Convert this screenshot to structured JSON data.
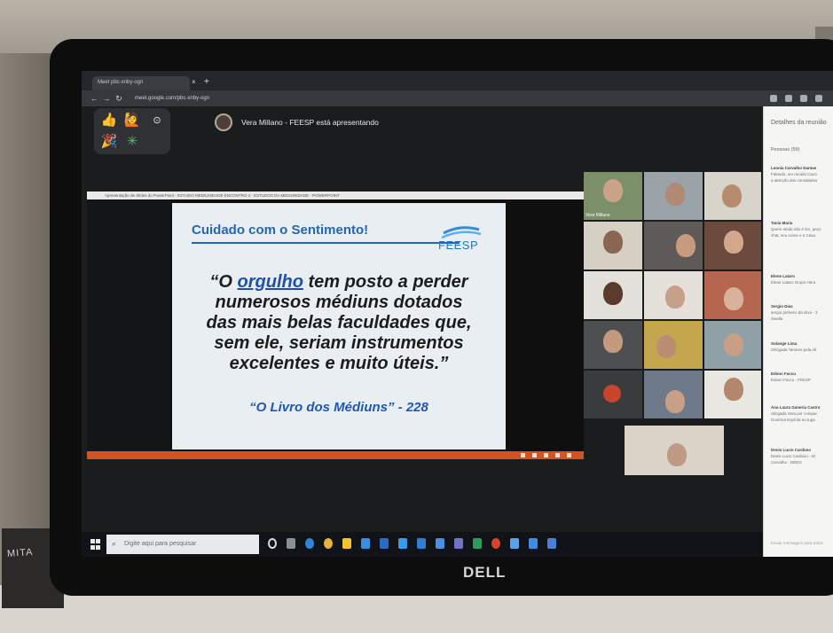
{
  "browser": {
    "tab_title": "Meet pbc-xnby-ogn",
    "tab_close": "×",
    "tab_new": "+",
    "url": "meet.google.com/pbc-xnby-ogn"
  },
  "meet": {
    "reactions": [
      "👍",
      "🙋",
      "🎉",
      "✳"
    ],
    "presenting_text": "Vera Millano - FEESP está apresentando"
  },
  "powerpoint": {
    "window_title": "Apresentação de Slides do PowerPoint - ESTUDO MEDIUNIDADE ENCONTRO 2 - ESTUDOS DA MEDIUNIDADE - POWERPOINT"
  },
  "slide": {
    "header": "Cuidado com o Sentimento!",
    "logo": "FEESP",
    "quote_open": "“O ",
    "quote_highlight": "orgulho",
    "quote_line1_rest": " tem posto a perder",
    "quote_line2": "numerosos médiuns dotados",
    "quote_line3": "das mais belas faculdades que,",
    "quote_line4": "sem ele, seriam instrumentos",
    "quote_line5": "excelentes e muito úteis.”",
    "source": "“O Livro dos Médiuns” - 228"
  },
  "participants": {
    "first_name_label": "Vera Millano"
  },
  "chat": {
    "title": "Detalhes da reunião",
    "people": "Pessoas (59)",
    "messages": [
      {
        "author": "Leonia Carvalho Dantas",
        "line1": "Falando, um recado Cava",
        "line2": "a atenção dos convidados"
      },
      {
        "author": "Tania Maria",
        "line1": "Quem ainda não é fez, peço",
        "line2": "chat, seu nome e a Casa"
      },
      {
        "author": "Elene Lataro",
        "line1": "Elene Lataro Grupo Hera",
        "line2": ""
      },
      {
        "author": "Sergio Dias",
        "line1": "sergio pinheiro da silva - 3",
        "line2": "Swella"
      },
      {
        "author": "Solange Lima",
        "line1": "Obrigada Tamires pela Alt",
        "line2": ""
      },
      {
        "author": "Edson Faccu",
        "line1": "Edson Faccu - FEESP",
        "line2": ""
      },
      {
        "author": "Ana Laura Ganeria Castro",
        "line1": "obrigada Vera por compar",
        "line2": "Doutrina Espírita no tuga"
      },
      {
        "author": "Denis Lucio Cardoso",
        "line1": "Denis Lucio Cardoso - Gr",
        "line2": "Carvalho - DEEG"
      }
    ],
    "input_placeholder": "Enviar mensagem para todos"
  },
  "taskbar": {
    "search_placeholder": "Digite aqui para pesquisar"
  },
  "device": {
    "brand": "DELL",
    "sticker": "MITA"
  },
  "colors": {
    "slide_accent": "#2367b1",
    "ppt_status": "#d35422",
    "source_text": "#1f57b3"
  }
}
